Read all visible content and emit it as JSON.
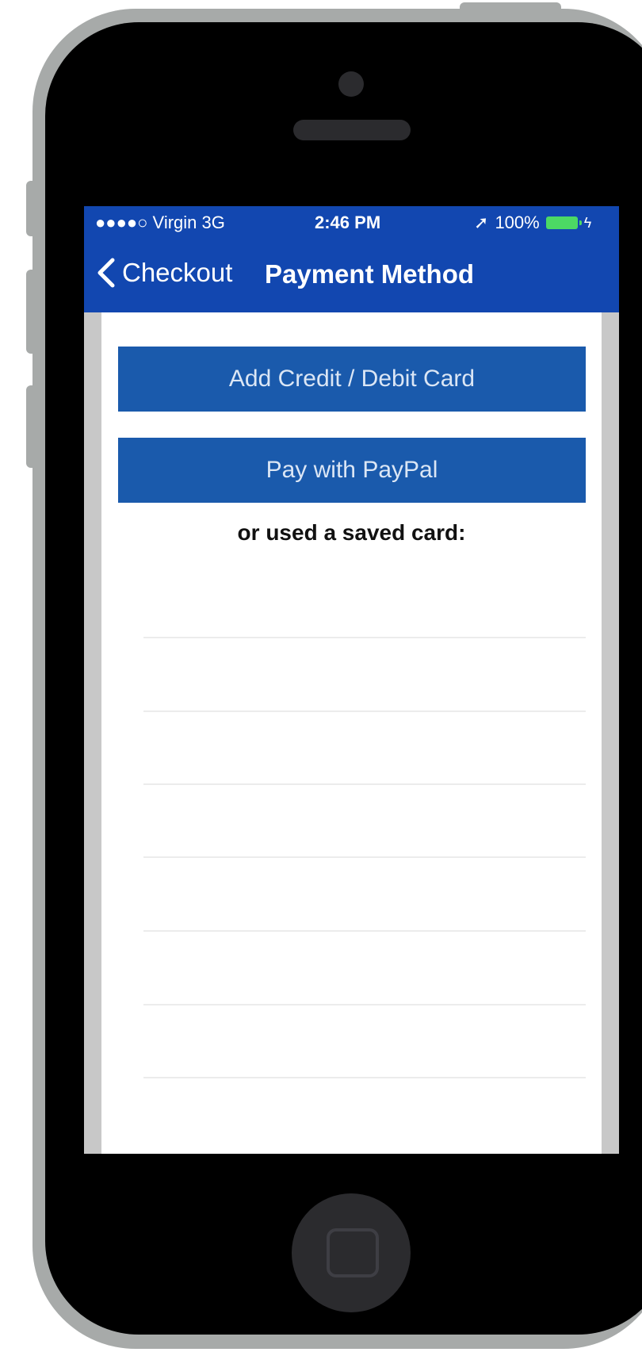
{
  "status_bar": {
    "carrier": "●●●●○ Virgin  3G",
    "time": "2:46 PM",
    "location_glyph": "➚",
    "battery_percent": "100%",
    "battery_level": 1.0
  },
  "nav": {
    "back_label": "Checkout",
    "title": "Payment Method",
    "background": "#1247b0"
  },
  "actions": {
    "add_card": "Add Credit / Debit Card",
    "paypal": "Pay with PayPal",
    "button_color": "#1a5aac"
  },
  "saved_cards": {
    "label": "or used a saved card:",
    "rows": [
      "",
      "",
      "",
      "",
      "",
      "",
      ""
    ]
  },
  "icons": [
    "back-chevron-icon",
    "location-arrow-icon",
    "battery-icon",
    "charging-bolt-icon",
    "home-button-icon"
  ]
}
